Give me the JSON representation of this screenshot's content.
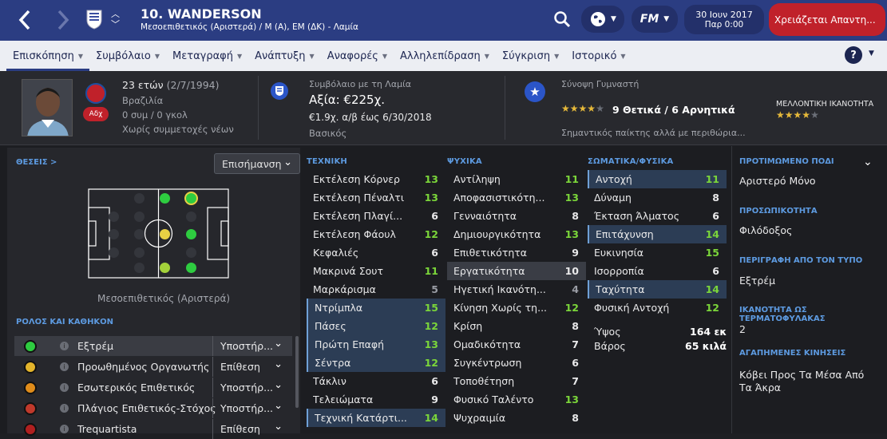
{
  "header": {
    "player_name": "10. WANDERSON",
    "subtitle": "Μεσοεπιθετικός (Αριστερά) / Μ (Α), ΕΜ (ΔΚ) - Λαμία",
    "date": "30 Ιουν 2017",
    "day_time": "Παρ 0:00",
    "alert": "Χρειάζεται Απαντη...",
    "fm_logo": "FM",
    "club_badge_icon": "club-crest"
  },
  "nav": [
    {
      "label": "Επισκόπηση"
    },
    {
      "label": "Συμβόλαιο"
    },
    {
      "label": "Μεταγραφή"
    },
    {
      "label": "Ανάπτυξη"
    },
    {
      "label": "Αναφορές"
    },
    {
      "label": "Αλληλεπίδραση"
    },
    {
      "label": "Σύγκριση"
    },
    {
      "label": "Ιστορικό"
    }
  ],
  "info": {
    "age": "23 ετών",
    "dob": "(2/7/1994)",
    "nationality": "Βραζιλία",
    "caps": "0 συμ / 0 γκολ",
    "youth": "Χωρίς συμμετοχές νέων",
    "badge": "Αδχ",
    "contract_label": "Συμβόλαιο με τη Λαμία",
    "value": "Αξία: €225χ.",
    "wage": "€1.9χ. α/β έως 6/30/2018",
    "squad_status": "Βασικός",
    "coach_label": "Σύνοψη Γυμναστή",
    "coach_summary": "9 Θετικά / 6 Αρνητικά",
    "coach_note": "Σημαντικός παίκτης αλλά με περιθώρια...",
    "coach_stars": 4,
    "potential_label": "ΜΕΛΛΟΝΤΙΚΗ ΙΚΑΝΟΤΗΤΑ",
    "potential_stars": 4
  },
  "positions": {
    "link": "ΘΕΣΕΙΣ >",
    "highlight_dd": "Επισήμανση",
    "position_label": "Μεσοεπιθετικός (Αριστερά)"
  },
  "roles": {
    "title": "ΡΟΛΟΣ ΚΑΙ ΚΑΘΗΚΟΝ",
    "items": [
      {
        "name": "Εξτρέμ",
        "duty": "Υποστήρ...",
        "color": "#2ecc40"
      },
      {
        "name": "Προωθημένος Οργανωτής",
        "duty": "Επίθεση",
        "color": "#e3b42b"
      },
      {
        "name": "Εσωτερικός Επιθετικός",
        "duty": "Υποστήρ...",
        "color": "#e08c1a"
      },
      {
        "name": "Πλάγιος Επιθετικός-Στόχος",
        "duty": "Υποστήρ...",
        "color": "#c0392b"
      },
      {
        "name": "Trequartista",
        "duty": "Επίθεση",
        "color": "#b02020"
      }
    ]
  },
  "technical": {
    "title": "ΤΕΧΝΙΚΗ",
    "attrs": [
      {
        "name": "Εκτέλεση Κόρνερ",
        "value": "13"
      },
      {
        "name": "Εκτέλεση Πέναλτι",
        "value": "13"
      },
      {
        "name": "Εκτέλεση Πλαγί...",
        "value": "6"
      },
      {
        "name": "Εκτέλεση Φάουλ",
        "value": "12"
      },
      {
        "name": "Κεφαλιές",
        "value": "6"
      },
      {
        "name": "Μακρινά Σουτ",
        "value": "11"
      },
      {
        "name": "Μαρκάρισμα",
        "value": "5"
      },
      {
        "name": "Ντρίμπλα",
        "value": "15"
      },
      {
        "name": "Πάσες",
        "value": "12"
      },
      {
        "name": "Πρώτη Επαφή",
        "value": "13"
      },
      {
        "name": "Σέντρα",
        "value": "12"
      },
      {
        "name": "Τάκλιν",
        "value": "6"
      },
      {
        "name": "Τελειώματα",
        "value": "9"
      },
      {
        "name": "Τεχνική Κατάρτι...",
        "value": "14"
      }
    ]
  },
  "mental": {
    "title": "ΨΥΧΙΚΑ",
    "attrs": [
      {
        "name": "Αντίληψη",
        "value": "11"
      },
      {
        "name": "Αποφασιστικότη...",
        "value": "13"
      },
      {
        "name": "Γενναιότητα",
        "value": "8"
      },
      {
        "name": "Δημιουργικότητα",
        "value": "13"
      },
      {
        "name": "Επιθετικότητα",
        "value": "9"
      },
      {
        "name": "Εργατικότητα",
        "value": "10"
      },
      {
        "name": "Ηγετική Ικανότη...",
        "value": "4"
      },
      {
        "name": "Κίνηση Χωρίς τη...",
        "value": "12"
      },
      {
        "name": "Κρίση",
        "value": "8"
      },
      {
        "name": "Ομαδικότητα",
        "value": "7"
      },
      {
        "name": "Συγκέντρωση",
        "value": "6"
      },
      {
        "name": "Τοποθέτηση",
        "value": "7"
      },
      {
        "name": "Φυσικό Ταλέντο",
        "value": "13"
      },
      {
        "name": "Ψυχραιμία",
        "value": "8"
      }
    ]
  },
  "physical": {
    "title": "ΣΩΜΑΤΙΚΑ/ΦΥΣΙΚΑ",
    "attrs": [
      {
        "name": "Αντοχή",
        "value": "11"
      },
      {
        "name": "Δύναμη",
        "value": "8"
      },
      {
        "name": "Έκταση Άλματος",
        "value": "6"
      },
      {
        "name": "Επιτάχυνση",
        "value": "14"
      },
      {
        "name": "Ευκινησία",
        "value": "15"
      },
      {
        "name": "Ισορροπία",
        "value": "6"
      },
      {
        "name": "Ταχύτητα",
        "value": "14"
      },
      {
        "name": "Φυσική Αντοχή",
        "value": "12"
      }
    ],
    "height_label": "Ύψος",
    "height": "164 εκ",
    "weight_label": "Βάρος",
    "weight": "65 κιλά"
  },
  "right_panel": {
    "foot_label": "ΠΡΟΤΙΜΩΜΕΝΟ ΠΟΔΙ",
    "foot": "Αριστερό Μόνο",
    "personality_label": "ΠΡΟΣΩΠΙΚΟΤΗΤΑ",
    "personality": "Φιλόδοξος",
    "media_label": "ΠΕΡΙΓΡΑΦΗ ΑΠΟ ΤΟΝ ΤΥΠΟ",
    "media": "Εξτρέμ",
    "gk_label": "ΙΚΑΝΟΤΗΤΑ ΩΣ ΤΕΡΜΑΤΟΦΥΛΑΚΑΣ",
    "gk": "2",
    "moves_label": "ΑΓΑΠΗΜΕΝΕΣ ΚΙΝΗΣΕΙΣ",
    "moves": "Κόβει Προς Τα Μέσα Από Τα Άκρα"
  }
}
